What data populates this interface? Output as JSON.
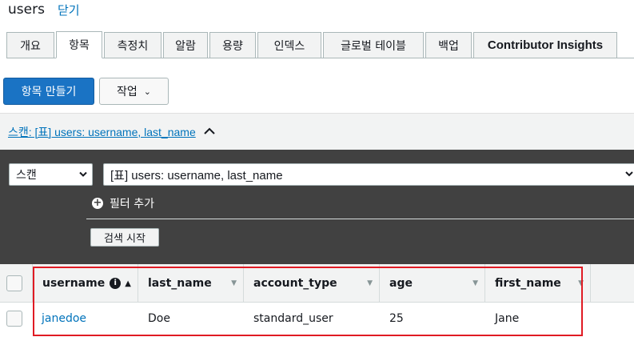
{
  "header": {
    "title": "users",
    "close_label": "닫기"
  },
  "tabs": [
    {
      "label": "개요"
    },
    {
      "label": "항목"
    },
    {
      "label": "측정치"
    },
    {
      "label": "알람"
    },
    {
      "label": "용량"
    },
    {
      "label": "인덱스"
    },
    {
      "label": "글로벌 테이블"
    },
    {
      "label": "백업"
    },
    {
      "label": "Contributor Insights"
    }
  ],
  "actions": {
    "create_item": "항목 만들기",
    "actions": "작업"
  },
  "scan_bar": {
    "link": "스캔: [표] users: username, last_name"
  },
  "query": {
    "mode": "스캔",
    "table": "[표] users: username, last_name",
    "add_filter": "필터 추가",
    "start_search": "검색 시작"
  },
  "table": {
    "columns": [
      "username",
      "last_name",
      "account_type",
      "age",
      "first_name"
    ],
    "rows": [
      {
        "username": "janedoe",
        "last_name": "Doe",
        "account_type": "standard_user",
        "age": "25",
        "first_name": "Jane"
      }
    ]
  },
  "colors": {
    "primary": "#1a73c4",
    "link": "#0073bb",
    "panel": "#414141",
    "highlight": "#e01b24"
  }
}
